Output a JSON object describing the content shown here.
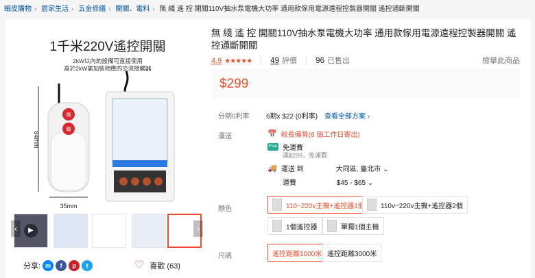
{
  "breadcrumb": {
    "items": [
      "蝦皮購物",
      "居家生活",
      "五金修繕",
      "開關．電料"
    ],
    "current": "無 綫 遙 控 開關110V抽水泵電機大功率 通用款傢用電源遠程控製器開關 遙控通斷開關"
  },
  "product": {
    "title": "無 綫 遙 控 開關110V抽水泵電機大功率 通用款傢用電源遠程控製器開關 遙控通斷開關",
    "rating": "4.9",
    "stars": "★★★★★",
    "reviews_count": "49",
    "reviews_label": "評價",
    "sold_count": "96",
    "sold_label": "已售出",
    "report_label": "檢舉此商品",
    "price": "$299"
  },
  "image": {
    "headline": "1千米220V遙控開關",
    "sub1": "2kW以內的設備可直接使用",
    "sub2": "高於2kW需加裝相應的交流接觸器",
    "dim_height": "84mm",
    "dim_width": "35mm",
    "remote_btn_on": "開",
    "remote_btn_off": "關"
  },
  "installment": {
    "label": "分期0利率",
    "value": "6期x $22 (0利率)",
    "link": "查看全部方案"
  },
  "shipping": {
    "label": "運送",
    "late_text": "較長備貨(6 個工作日寄出)",
    "free_badge": "Free",
    "free_label": "免運費",
    "free_sub": "滿$299，免運費",
    "to_label": "運送 到",
    "to_value": "大同區, 臺北市",
    "fee_label": "運費",
    "fee_value": "$45 - $65"
  },
  "color": {
    "label": "顏色",
    "options": [
      "110~220v主機+遙控器1個",
      "110v~220v主機+遙控器2個",
      "1個遙控器",
      "單獨1個主機"
    ]
  },
  "size": {
    "label": "尺碼",
    "options": [
      "遙控距離1000米",
      "遙控距離3000米"
    ]
  },
  "share": {
    "label": "分享:"
  },
  "like": {
    "label": "喜歡 (63)"
  },
  "colors": {
    "accent": "#ee4d2d",
    "link": "#0055aa",
    "free": "#26aa99"
  }
}
